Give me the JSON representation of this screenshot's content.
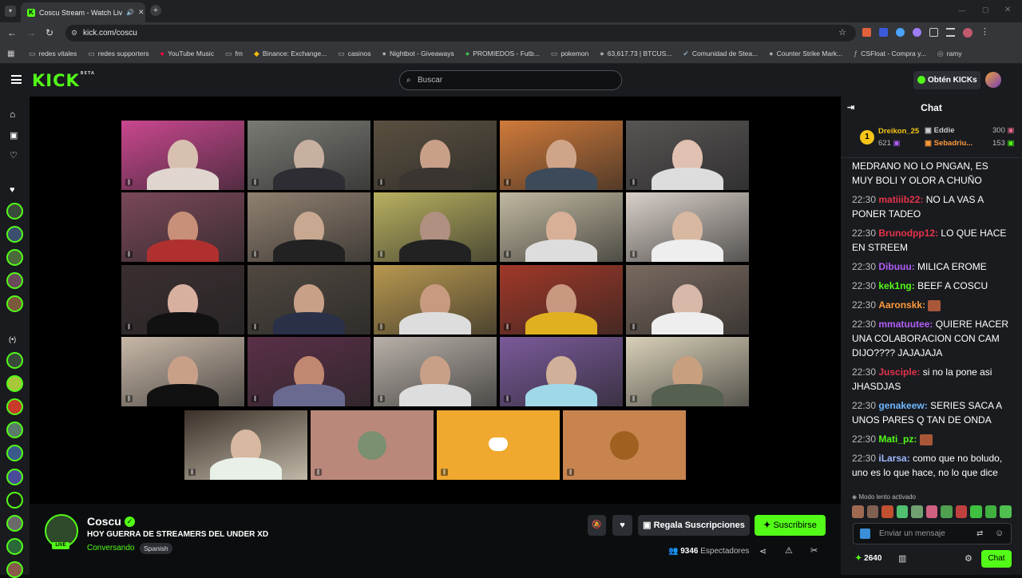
{
  "browser": {
    "tab_title": "Coscu Stream - Watch Live",
    "url": "kick.com/coscu",
    "bookmarks": [
      "redes vitales",
      "redes supporters",
      "YouTube Music",
      "fm",
      "Binance: Exchange...",
      "casinos",
      "Nightbot - Giveaways",
      "PROMIEDOS - Futb...",
      "pokemon",
      "63,617.73 | BTCUS...",
      "Comunidad de Stea...",
      "Counter Strike Mark...",
      "CSFloat - Compra y...",
      "ramy"
    ]
  },
  "nav": {
    "logo": "KICK",
    "beta": "BETA",
    "search_placeholder": "Buscar",
    "kicks_button": "Obtén KICKs"
  },
  "stream": {
    "channel_name": "Coscu",
    "title": "HOY GUERRA DE STREAMERS DEL UNDER XD",
    "category": "Conversando",
    "language": "Spanish",
    "live_badge": "LIVE",
    "gift_button": "Regala Suscripciones",
    "subscribe_button": "Suscribirse",
    "viewers_count": "9346",
    "viewers_label": "Espectadores"
  },
  "chat": {
    "header": "Chat",
    "leaderboard": [
      {
        "rank": "1",
        "name": "Dreikon_25",
        "value": "621"
      },
      {
        "name": "Eddie",
        "value": "300"
      },
      {
        "name": "Sebadriu...",
        "value": "153"
      }
    ],
    "partial_message": "MEDRANO NO LO PNGAN, ES MUY BOLI Y OLOR A CHUÑO",
    "messages": [
      {
        "time": "22:30",
        "user": "matiiib22",
        "color": "#e5344b",
        "text": "NO LA VAS A PONER TADEO"
      },
      {
        "time": "22:30",
        "user": "Brunodpp12",
        "color": "#e5344b",
        "text": "LO QUE HACE EN STREEM"
      },
      {
        "time": "22:30",
        "user": "Dibuuu",
        "color": "#b35ef7",
        "text": "MILICA EROME"
      },
      {
        "time": "22:30",
        "user": "kek1ng",
        "color": "#53fc18",
        "text": "BEEF A COSCU"
      },
      {
        "time": "22:30",
        "user": "Aaronskk",
        "color": "#ff9a3c",
        "text": ""
      },
      {
        "time": "22:30",
        "user": "mmatuutee",
        "color": "#b35ef7",
        "text": "QUIERE HACER UNA COLABORACION CON CAM DIJO???? JAJAJAJA"
      },
      {
        "time": "22:30",
        "user": "Jusciple",
        "color": "#e5344b",
        "text": "si no la pone asi JHASDJAS"
      },
      {
        "time": "22:30",
        "user": "genakeew",
        "color": "#6fb8ff",
        "text": "SERIES SACA A UNOS PARES Q TAN DE ONDA"
      },
      {
        "time": "22:30",
        "user": "Mati_pz",
        "color": "#53fc18",
        "text": ""
      },
      {
        "time": "22:30",
        "user": "iLarsa",
        "color": "#9fb8ff",
        "text": "como que no boludo, uno es lo que hace, no lo que dice"
      }
    ],
    "slow_mode": "Modo lento activado",
    "input_placeholder": "Enviar un mensaje",
    "points": "2640",
    "chat_button": "Chat"
  },
  "colors": {
    "accent": "#53fc18",
    "background": "#0b0e0f",
    "panel": "#191b1f"
  }
}
